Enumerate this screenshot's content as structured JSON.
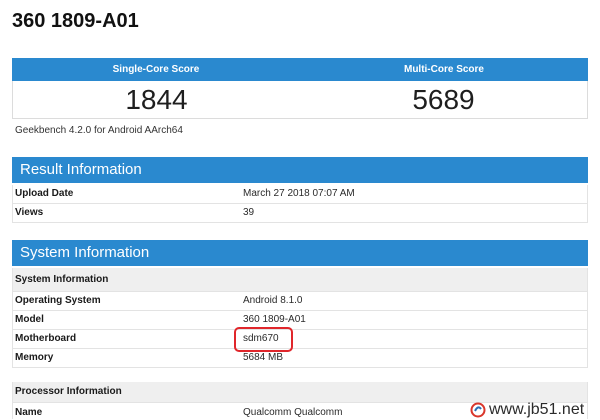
{
  "device_title": "360 1809-A01",
  "scores": {
    "single_core": {
      "label": "Single-Core Score",
      "value": "1844"
    },
    "multi_core": {
      "label": "Multi-Core Score",
      "value": "5689"
    }
  },
  "version_text": "Geekbench 4.2.0 for Android AArch64",
  "result_information": {
    "heading": "Result Information",
    "rows": [
      {
        "label": "Upload Date",
        "value": "March 27 2018 07:07 AM"
      },
      {
        "label": "Views",
        "value": "39"
      }
    ]
  },
  "system_information": {
    "heading": "System Information",
    "groups": [
      {
        "title": "System Information",
        "rows": [
          {
            "label": "Operating System",
            "value": "Android 8.1.0"
          },
          {
            "label": "Model",
            "value": "360 1809-A01"
          },
          {
            "label": "Motherboard",
            "value": "sdm670"
          },
          {
            "label": "Memory",
            "value": "5684 MB"
          }
        ]
      },
      {
        "title": "Processor Information",
        "rows": [
          {
            "label": "Name",
            "value": "Qualcomm Qualcomm"
          }
        ]
      }
    ]
  },
  "watermark": {
    "text": "www.jb51.net",
    "logo_icon": "jb51-logo-icon"
  },
  "colors": {
    "header_blue": "#2a89cf",
    "highlight_red": "#e0262b",
    "subheader_bg": "#efefef",
    "row_border": "#e3e3e3"
  }
}
